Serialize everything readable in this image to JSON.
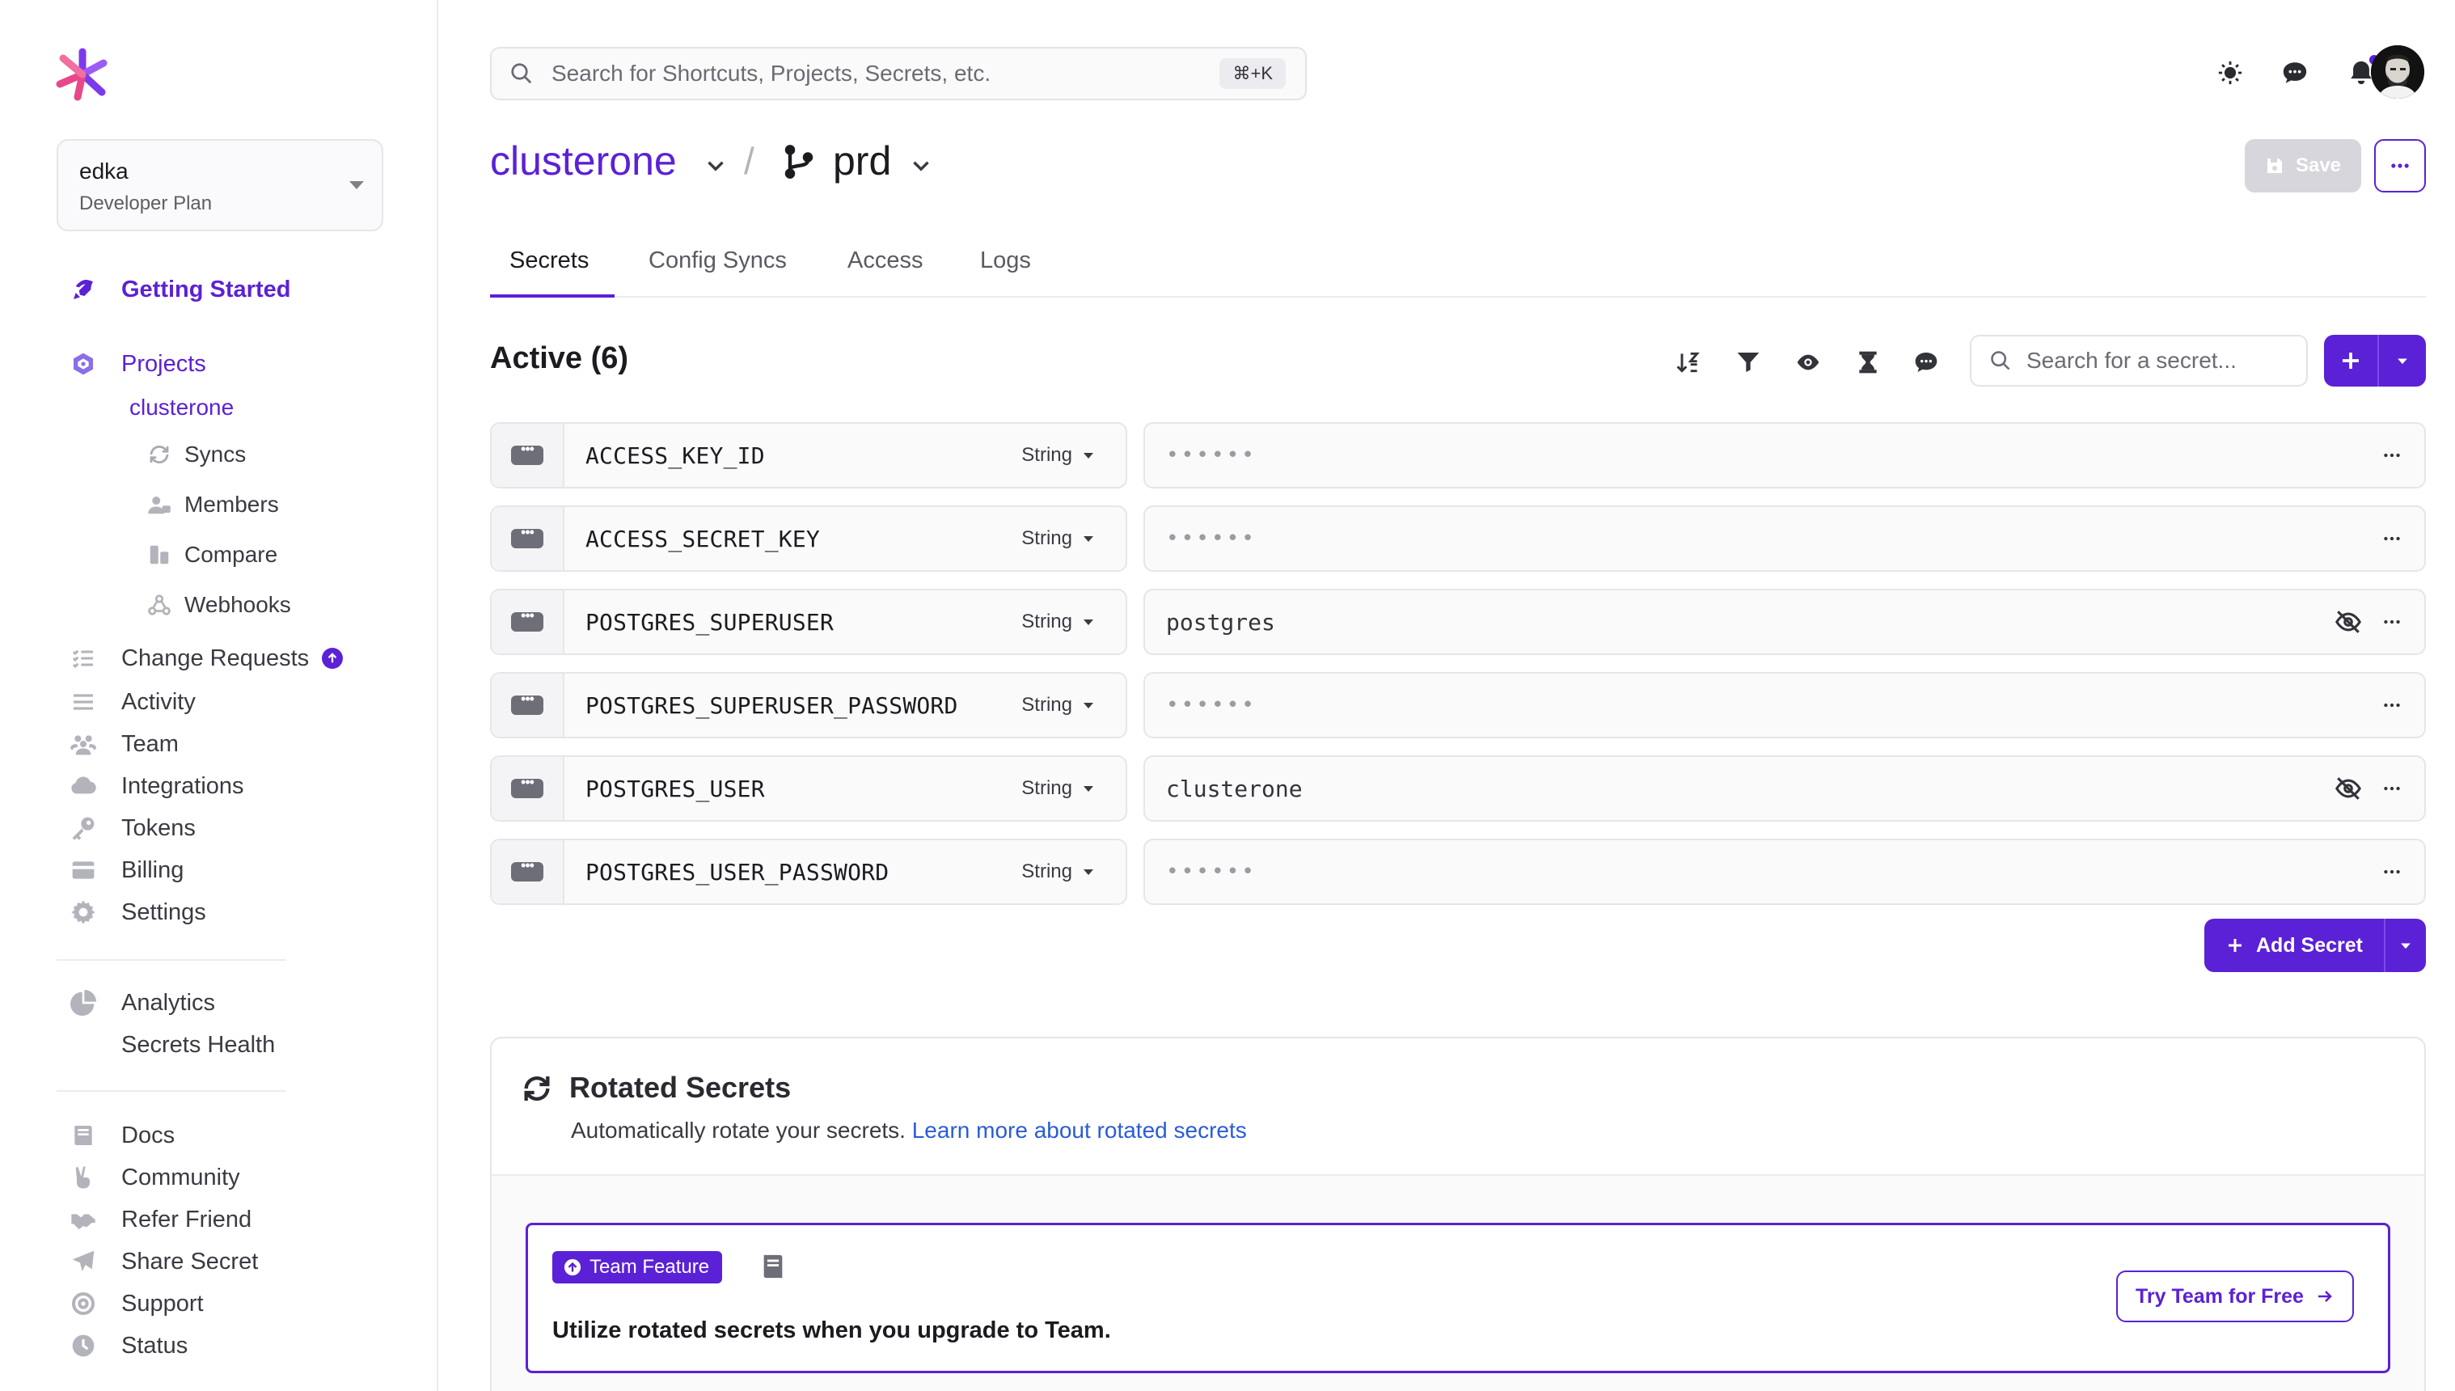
{
  "colors": {
    "accent": "#5b21d6",
    "link": "#2a5cd6",
    "muted": "#6b6b74"
  },
  "workspace": {
    "name": "edka",
    "plan": "Developer Plan"
  },
  "sidebar": {
    "getting_started": "Getting Started",
    "projects": "Projects",
    "current_project": "clusterone",
    "sub_items": [
      "Syncs",
      "Members",
      "Compare",
      "Webhooks"
    ],
    "items": [
      "Change Requests",
      "Activity",
      "Team",
      "Integrations",
      "Tokens",
      "Billing",
      "Settings"
    ],
    "analytics": [
      "Analytics",
      "Secrets Health"
    ],
    "footer": [
      "Docs",
      "Community",
      "Refer Friend",
      "Share Secret",
      "Support",
      "Status"
    ]
  },
  "topbar": {
    "search_placeholder": "Search for Shortcuts, Projects, Secrets, etc.",
    "shortcut": "⌘+K",
    "icons": [
      "sun-icon",
      "chat-icon",
      "bell-icon"
    ]
  },
  "header": {
    "project": "clusterone",
    "separator": "/",
    "environment": "prd",
    "save_label": "Save"
  },
  "tabs": [
    "Secrets",
    "Config Syncs",
    "Access",
    "Logs"
  ],
  "secrets": {
    "title": "Active (6)",
    "search_placeholder": "Search for a secret...",
    "toolbar_icons": [
      "sort-icon",
      "filter-icon",
      "eye-icon",
      "hourglass-icon",
      "comment-icon"
    ],
    "rows": [
      {
        "key": "ACCESS_KEY_ID",
        "type": "String",
        "value": "••••••",
        "masked": true
      },
      {
        "key": "ACCESS_SECRET_KEY",
        "type": "String",
        "value": "••••••",
        "masked": true
      },
      {
        "key": "POSTGRES_SUPERUSER",
        "type": "String",
        "value": "postgres",
        "masked": false
      },
      {
        "key": "POSTGRES_SUPERUSER_PASSWORD",
        "type": "String",
        "value": "••••••",
        "masked": true
      },
      {
        "key": "POSTGRES_USER",
        "type": "String",
        "value": "clusterone",
        "masked": false
      },
      {
        "key": "POSTGRES_USER_PASSWORD",
        "type": "String",
        "value": "••••••",
        "masked": true
      }
    ],
    "add_label": "Add Secret"
  },
  "rotated": {
    "title": "Rotated Secrets",
    "desc": "Automatically rotate your secrets.",
    "link": "Learn more about rotated secrets",
    "badge": "Team Feature",
    "upgrade_text": "Utilize rotated secrets when you upgrade to Team.",
    "cta": "Try Team for Free"
  }
}
